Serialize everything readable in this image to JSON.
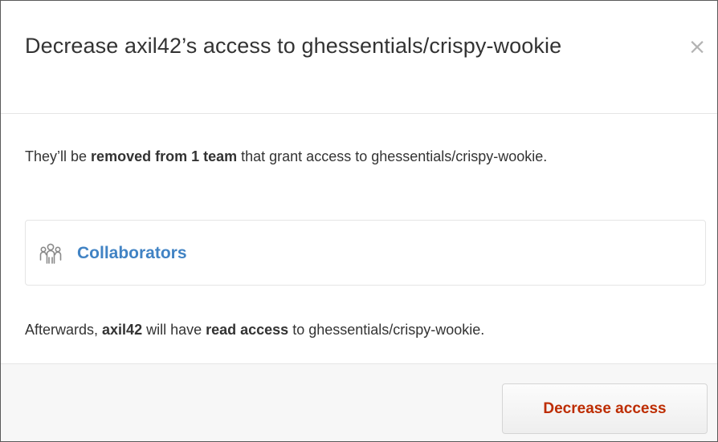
{
  "dialog": {
    "title": "Decrease axil42’s access to ghessentials/crispy-wookie",
    "close_label": "×"
  },
  "body": {
    "removed_prefix": "They’ll be ",
    "removed_strong": "removed from 1 team",
    "removed_suffix": " that grant access to ghessentials/crispy-wookie.",
    "teams": [
      {
        "name": "Collaborators",
        "icon": "team-icon"
      }
    ],
    "afterwards_prefix": "Afterwards, ",
    "afterwards_user": "axil42",
    "afterwards_mid": " will have ",
    "afterwards_access": "read access",
    "afterwards_suffix": " to ghessentials/crispy-wookie."
  },
  "footer": {
    "decrease_button_label": "Decrease access"
  },
  "colors": {
    "link": "#4183c4",
    "danger": "#bd2c00",
    "text": "#333333",
    "border": "#e5e5e5"
  }
}
